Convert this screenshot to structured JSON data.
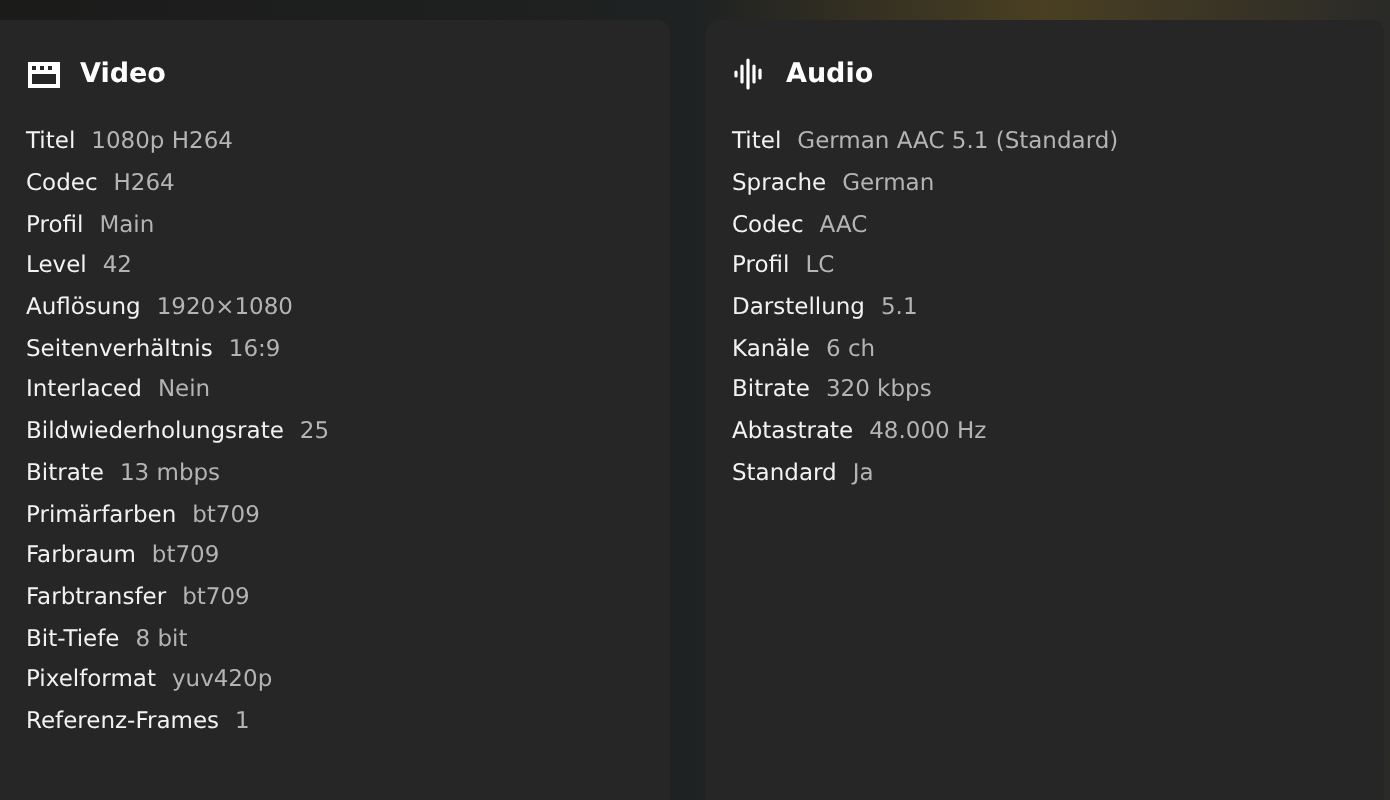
{
  "panels": [
    {
      "title": "Video",
      "kind": "video",
      "rows": [
        {
          "label": "Titel",
          "value": "1080p H264"
        },
        {
          "label": "Codec",
          "value": "H264"
        },
        {
          "label": "Profil",
          "value": "Main"
        },
        {
          "label": "Level",
          "value": "42"
        },
        {
          "label": "Auflösung",
          "value": "1920×1080"
        },
        {
          "label": "Seitenverhältnis",
          "value": "16:9"
        },
        {
          "label": "Interlaced",
          "value": "Nein"
        },
        {
          "label": "Bildwiederholungsrate",
          "value": "25"
        },
        {
          "label": "Bitrate",
          "value": "13 mbps"
        },
        {
          "label": "Primärfarben",
          "value": "bt709"
        },
        {
          "label": "Farbraum",
          "value": "bt709"
        },
        {
          "label": "Farbtransfer",
          "value": "bt709"
        },
        {
          "label": "Bit-Tiefe",
          "value": "8 bit"
        },
        {
          "label": "Pixelformat",
          "value": "yuv420p"
        },
        {
          "label": "Referenz-Frames",
          "value": "1"
        }
      ]
    },
    {
      "title": "Audio",
      "kind": "audio",
      "rows": [
        {
          "label": "Titel",
          "value": "German AAC 5.1 (Standard)"
        },
        {
          "label": "Sprache",
          "value": "German"
        },
        {
          "label": "Codec",
          "value": "AAC"
        },
        {
          "label": "Profil",
          "value": "LC"
        },
        {
          "label": "Darstellung",
          "value": "5.1"
        },
        {
          "label": "Kanäle",
          "value": "6 ch"
        },
        {
          "label": "Bitrate",
          "value": "320 kbps"
        },
        {
          "label": "Abtastrate",
          "value": "48.000 Hz"
        },
        {
          "label": "Standard",
          "value": "Ja"
        }
      ]
    }
  ]
}
